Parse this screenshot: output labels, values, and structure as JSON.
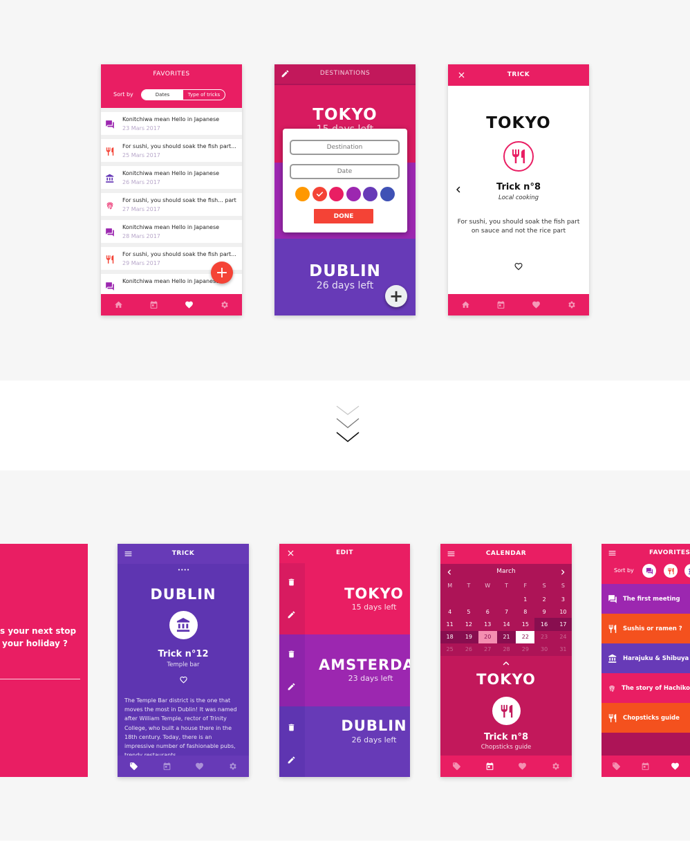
{
  "colors": {
    "pink": "#e91e63",
    "purple": "#9c27b0",
    "deep_purple": "#673ab7",
    "orange_red": "#f44336",
    "bg": "#f6f6f6"
  },
  "fav1": {
    "title": "FAVORITES",
    "sort_label": "Sort by",
    "sort_options": [
      "Dates",
      "Type of tricks"
    ],
    "items": [
      {
        "title": "Konitchiwa mean Hello in Japanese",
        "date": "23 Mars 2017",
        "icon": "chat-icon"
      },
      {
        "title": "For sushi, you should soak the fish part...",
        "date": "25 Mars 2017",
        "icon": "fork-knife-icon"
      },
      {
        "title": "Konitchiwa mean Hello in Japanese",
        "date": "26 Mars 2017",
        "icon": "museum-icon"
      },
      {
        "title": "For sushi, you should soak the fish... part",
        "date": "27 Mars 2017",
        "icon": "fingerprint-icon"
      },
      {
        "title": "Konitchiwa mean Hello in Japanese",
        "date": "28 Mars 2017",
        "icon": "chat-icon"
      },
      {
        "title": "For sushi, you should soak the fish part...",
        "date": "29 Mars 2017",
        "icon": "fork-knife-icon"
      },
      {
        "title": "Konitchiwa mean Hello in Japanese",
        "date": "",
        "icon": "chat-icon"
      }
    ],
    "fab": "+"
  },
  "dest1": {
    "title": "DESTINATIONS",
    "tokyo": "TOKYO",
    "tokyo_sub": "15 days left",
    "dublin": "DUBLIN",
    "dublin_sub": "26 days left",
    "placeholder_destination": "Destination",
    "placeholder_date": "Date",
    "swatches": [
      "#ff9800",
      "#f44336",
      "#e91e63",
      "#9c27b0",
      "#673ab7",
      "#3f51b5"
    ],
    "done": "DONE",
    "fab": "+"
  },
  "trick1": {
    "title": "TRICK",
    "city": "TOKYO",
    "trick": "Trick n°8",
    "subtitle": "Local cooking",
    "body": "For sushi, you should soak the fish part on sauce and not the rice part"
  },
  "phone0": {
    "line1": "s your next stop",
    "line2": "your holiday ?"
  },
  "trick2": {
    "title": "TRICK",
    "dots": "• • • •",
    "city": "DUBLIN",
    "trick": "Trick n°12",
    "subtitle": "Temple bar",
    "body": "The Temple Bar district is the one that moves the most in Dublin! It was named after William Temple, rector of Trinity College, who built a house there in the 18th century. Today, there is an impressive number of fashionable pubs, trendy restaurants,"
  },
  "edit": {
    "title": "EDIT",
    "items": [
      {
        "city": "TOKYO",
        "sub": "15 days left"
      },
      {
        "city": "AMSTERDAM",
        "sub": "23 days left"
      },
      {
        "city": "DUBLIN",
        "sub": "26 days left"
      }
    ]
  },
  "calendar": {
    "title": "CALENDAR",
    "month": "March",
    "weekdays": [
      "M",
      "T",
      "W",
      "T",
      "F",
      "S",
      "S"
    ],
    "days": [
      "",
      "",
      "",
      "",
      "1",
      "2",
      "3",
      "4",
      "5",
      "6",
      "7",
      "8",
      "9",
      "10",
      "11",
      "12",
      "13",
      "14",
      "15",
      "16",
      "17",
      "18",
      "19",
      "20",
      "21",
      "22",
      "23",
      "24",
      "25",
      "26",
      "27",
      "28",
      "29",
      "30",
      "31"
    ],
    "city": "TOKYO",
    "trick": "Trick n°8",
    "subtitle": "Chopsticks guide"
  },
  "fav2": {
    "title": "FAVORITES",
    "sort_label": "Sort by",
    "items": [
      {
        "label": "The first meeting",
        "color": "#9c27b0",
        "icon": "chat-icon"
      },
      {
        "label": "Sushis or ramen ?",
        "color": "#f4511e",
        "icon": "fork-knife-icon"
      },
      {
        "label": "Harajuku & Shibuya",
        "color": "#673ab7",
        "icon": "museum-icon"
      },
      {
        "label": "The story of Hachiko",
        "color": "#e91e63",
        "icon": "fingerprint-icon"
      },
      {
        "label": "Chopsticks guide",
        "color": "#f4511e",
        "icon": "fork-knife-icon"
      }
    ]
  }
}
